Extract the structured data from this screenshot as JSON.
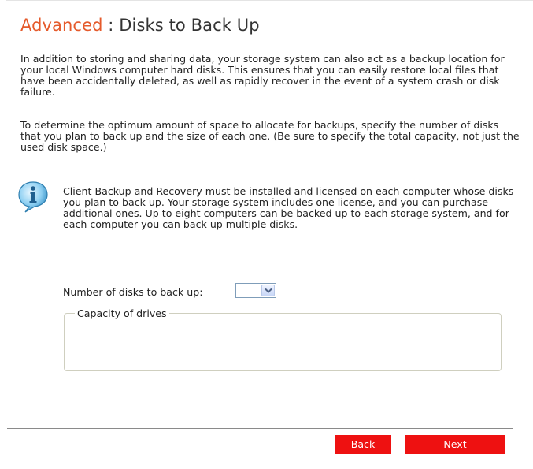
{
  "page": {
    "title_accent": "Advanced",
    "title_separator": " : ",
    "title_rest": "Disks to Back Up"
  },
  "intro": {
    "paragraph1": "In addition to storing and sharing data, your storage system can also act as a backup location for your local Windows computer hard disks. This ensures that you can easily restore local files that have been accidentally deleted, as well as rapidly recover in the event of a system crash or disk failure.",
    "paragraph2": "To determine the optimum amount of space to allocate for backups, specify the number of disks that you plan to back up and the size of each one. (Be sure to specify the total capacity, not just the used disk space.)"
  },
  "info": {
    "icon": "info-icon",
    "text": "Client Backup and Recovery must be installed and licensed on each computer whose disks you plan to back up. Your storage system includes one license, and you can purchase additional ones. Up to eight computers can be backed up to each storage system, and for each computer you can back up multiple disks."
  },
  "form": {
    "disks_label": "Number of disks to back up:",
    "disks_selected": "",
    "capacity_legend": "Capacity of drives"
  },
  "buttons": {
    "back": "Back",
    "next": "Next"
  },
  "colors": {
    "title_accent": "#e55a2b",
    "button": "#ee1111",
    "button_text": "#ffffff"
  }
}
